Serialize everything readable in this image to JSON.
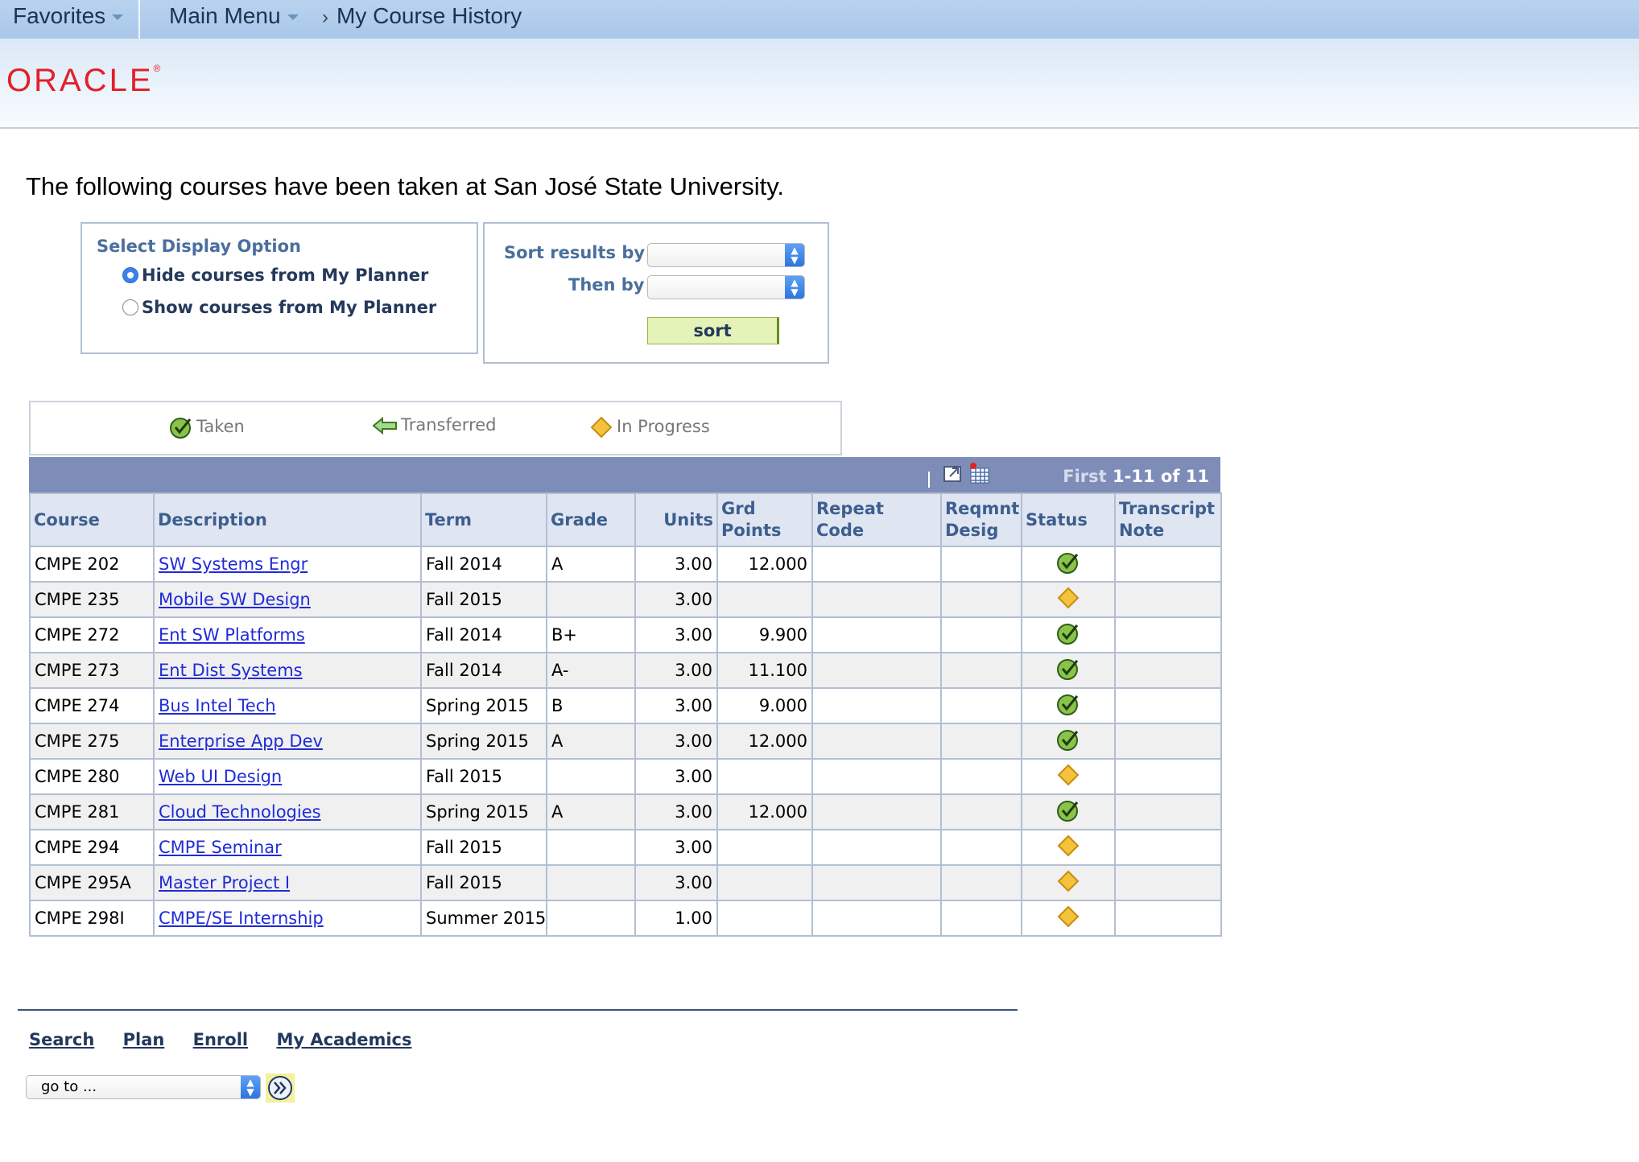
{
  "nav": {
    "favorites": "Favorites",
    "main_menu": "Main Menu",
    "breadcrumb": "My Course History"
  },
  "header": {
    "logo": "ORACLE"
  },
  "intro": "The following courses have been taken at San José State University.",
  "display_option": {
    "title": "Select Display Option",
    "options": [
      "Hide courses from My Planner",
      "Show courses from My Planner"
    ],
    "selected_index": 0
  },
  "sort": {
    "sort_label": "Sort results by",
    "then_label": "Then by",
    "sort_value": "",
    "then_value": "",
    "button": "sort"
  },
  "legend": {
    "taken": "Taken",
    "transferred": "Transferred",
    "in_progress": "In Progress"
  },
  "grid": {
    "counter_first": "First",
    "counter_range": "1-11 of 11",
    "columns": [
      "Course",
      "Description",
      "Term",
      "Grade",
      "Units",
      "Grd Points",
      "Repeat Code",
      "Reqmnt Desig",
      "Status",
      "Transcript Note"
    ],
    "rows": [
      {
        "course": "CMPE 202",
        "description": "SW Systems Engr",
        "term": "Fall 2014",
        "grade": "A",
        "units": "3.00",
        "points": "12.000",
        "repeat": "",
        "reqmnt": "",
        "status": "taken",
        "note": ""
      },
      {
        "course": "CMPE 235",
        "description": "Mobile SW Design",
        "term": "Fall 2015",
        "grade": "",
        "units": "3.00",
        "points": "",
        "repeat": "",
        "reqmnt": "",
        "status": "in-progress",
        "note": ""
      },
      {
        "course": "CMPE 272",
        "description": "Ent SW Platforms",
        "term": "Fall 2014",
        "grade": "B+",
        "units": "3.00",
        "points": "9.900",
        "repeat": "",
        "reqmnt": "",
        "status": "taken",
        "note": ""
      },
      {
        "course": "CMPE 273",
        "description": "Ent Dist Systems",
        "term": "Fall 2014",
        "grade": "A-",
        "units": "3.00",
        "points": "11.100",
        "repeat": "",
        "reqmnt": "",
        "status": "taken",
        "note": ""
      },
      {
        "course": "CMPE 274",
        "description": "Bus Intel Tech",
        "term": "Spring 2015",
        "grade": "B",
        "units": "3.00",
        "points": "9.000",
        "repeat": "",
        "reqmnt": "",
        "status": "taken",
        "note": ""
      },
      {
        "course": "CMPE 275",
        "description": "Enterprise App Dev",
        "term": "Spring 2015",
        "grade": "A",
        "units": "3.00",
        "points": "12.000",
        "repeat": "",
        "reqmnt": "",
        "status": "taken",
        "note": ""
      },
      {
        "course": "CMPE 280",
        "description": "Web UI Design",
        "term": "Fall 2015",
        "grade": "",
        "units": "3.00",
        "points": "",
        "repeat": "",
        "reqmnt": "",
        "status": "in-progress",
        "note": ""
      },
      {
        "course": "CMPE 281",
        "description": "Cloud Technologies",
        "term": "Spring 2015",
        "grade": "A",
        "units": "3.00",
        "points": "12.000",
        "repeat": "",
        "reqmnt": "",
        "status": "taken",
        "note": ""
      },
      {
        "course": "CMPE 294",
        "description": "CMPE Seminar",
        "term": "Fall 2015",
        "grade": "",
        "units": "3.00",
        "points": "",
        "repeat": "",
        "reqmnt": "",
        "status": "in-progress",
        "note": ""
      },
      {
        "course": "CMPE 295A",
        "description": "Master Project I",
        "term": "Fall 2015",
        "grade": "",
        "units": "3.00",
        "points": "",
        "repeat": "",
        "reqmnt": "",
        "status": "in-progress",
        "note": ""
      },
      {
        "course": "CMPE 298I",
        "description": "CMPE/SE Internship",
        "term": "Summer 2015",
        "grade": "",
        "units": "1.00",
        "points": "",
        "repeat": "",
        "reqmnt": "",
        "status": "in-progress",
        "note": ""
      }
    ]
  },
  "footer": {
    "links": [
      "Search",
      "Plan",
      "Enroll",
      "My Academics"
    ],
    "goto_value": "go to ..."
  },
  "colors": {
    "accent_blue": "#3d5e8f",
    "grid_nav": "#7e8cb8",
    "oracle_red": "#e2202a",
    "taken_green": "#5aa02c",
    "in_progress_yellow": "#f5c23c"
  }
}
